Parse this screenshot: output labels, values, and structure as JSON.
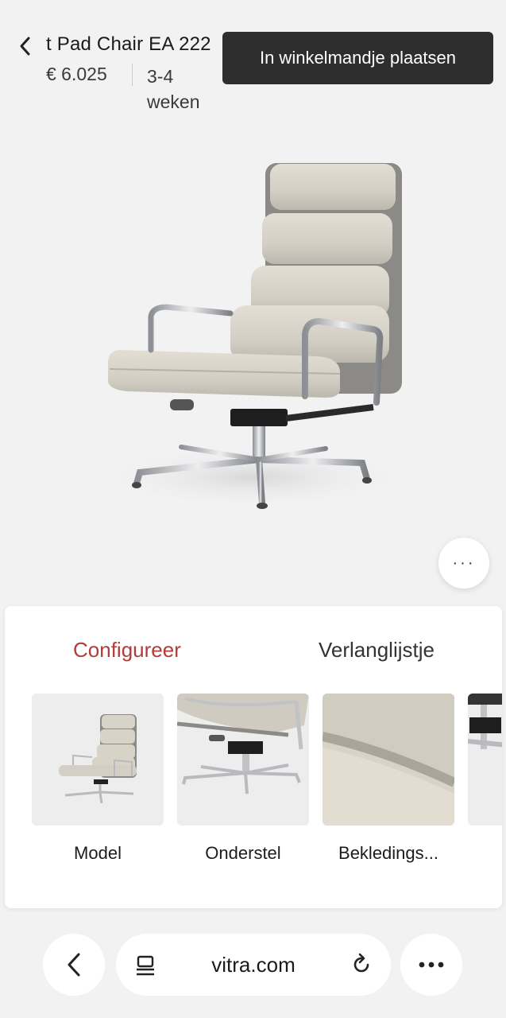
{
  "header": {
    "title": "t Pad Chair EA 222",
    "price": "€ 6.025",
    "delivery": "3-4 weken",
    "cart_button_label": "In winkelmandje plaatsen"
  },
  "hero": {
    "more_label": "···"
  },
  "panel": {
    "tabs": [
      {
        "label": "Configureer",
        "active": true
      },
      {
        "label": "Verlanglijstje",
        "active": false
      }
    ],
    "options": [
      {
        "label": "Model",
        "icon": "chair-thumbnail"
      },
      {
        "label": "Onderstel",
        "icon": "base-thumbnail"
      },
      {
        "label": "Bekledings...",
        "icon": "upholstery-thumbnail"
      },
      {
        "label": "",
        "icon": "armrest-thumbnail"
      }
    ]
  },
  "browser": {
    "url": "vitra.com"
  },
  "colors": {
    "accent": "#b53a3a",
    "button_dark": "#2e2e2e",
    "upholstery": "#d7d3c7",
    "chrome": "#c0c2c6"
  }
}
